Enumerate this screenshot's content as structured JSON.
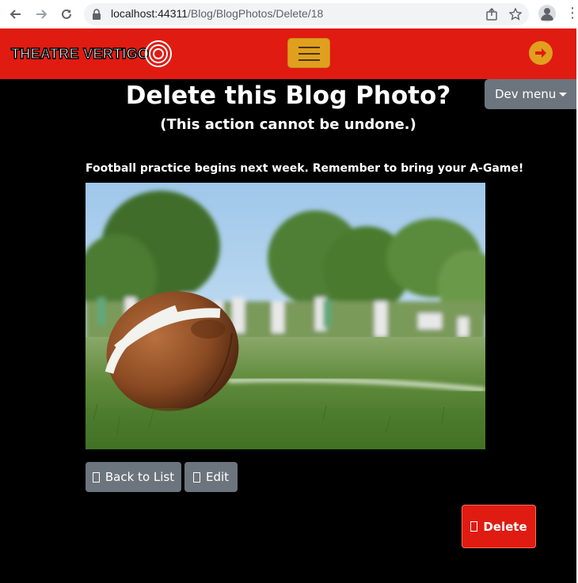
{
  "browser": {
    "url_host": "localhost:44311",
    "url_path": "/Blog/BlogPhotos/Delete/18"
  },
  "site": {
    "logo_text": "THEATRE VERTIGO",
    "brand_color": "#e01b12",
    "accent_color": "#e0a01e"
  },
  "dev_menu": {
    "label": "Dev menu"
  },
  "page": {
    "title": "Delete this Blog Photo?",
    "subtitle": "(This action cannot be undone.)",
    "caption": "Football practice begins next week. Remember to bring your A-Game!"
  },
  "actions": {
    "back_label": "Back to List",
    "edit_label": "Edit",
    "delete_label": "Delete"
  }
}
